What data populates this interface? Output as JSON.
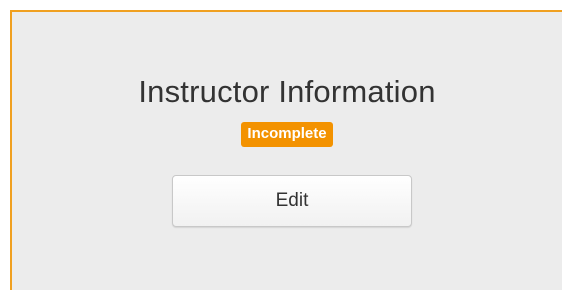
{
  "section": {
    "title": "Instructor Information",
    "status_badge": "Incomplete",
    "edit_label": "Edit"
  },
  "colors": {
    "accent_border": "#f0a020",
    "badge_bg": "#f39200",
    "panel_bg": "#ececec"
  }
}
